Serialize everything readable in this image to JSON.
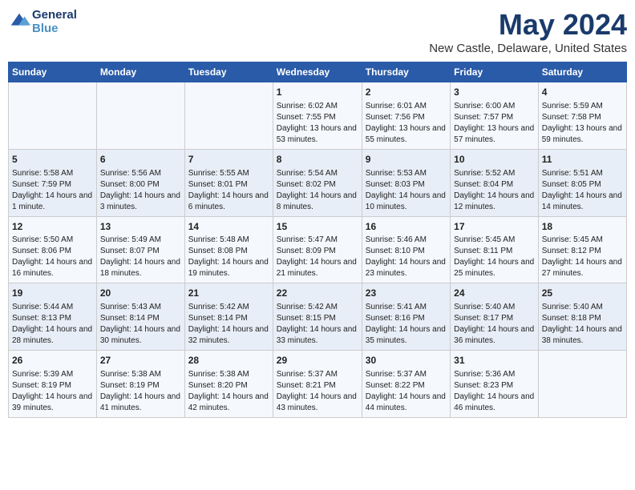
{
  "header": {
    "logo_line1": "General",
    "logo_line2": "Blue",
    "month_title": "May 2024",
    "location": "New Castle, Delaware, United States"
  },
  "days_of_week": [
    "Sunday",
    "Monday",
    "Tuesday",
    "Wednesday",
    "Thursday",
    "Friday",
    "Saturday"
  ],
  "weeks": [
    [
      {
        "day": "",
        "content": ""
      },
      {
        "day": "",
        "content": ""
      },
      {
        "day": "",
        "content": ""
      },
      {
        "day": "1",
        "content": "Sunrise: 6:02 AM\nSunset: 7:55 PM\nDaylight: 13 hours and 53 minutes."
      },
      {
        "day": "2",
        "content": "Sunrise: 6:01 AM\nSunset: 7:56 PM\nDaylight: 13 hours and 55 minutes."
      },
      {
        "day": "3",
        "content": "Sunrise: 6:00 AM\nSunset: 7:57 PM\nDaylight: 13 hours and 57 minutes."
      },
      {
        "day": "4",
        "content": "Sunrise: 5:59 AM\nSunset: 7:58 PM\nDaylight: 13 hours and 59 minutes."
      }
    ],
    [
      {
        "day": "5",
        "content": "Sunrise: 5:58 AM\nSunset: 7:59 PM\nDaylight: 14 hours and 1 minute."
      },
      {
        "day": "6",
        "content": "Sunrise: 5:56 AM\nSunset: 8:00 PM\nDaylight: 14 hours and 3 minutes."
      },
      {
        "day": "7",
        "content": "Sunrise: 5:55 AM\nSunset: 8:01 PM\nDaylight: 14 hours and 6 minutes."
      },
      {
        "day": "8",
        "content": "Sunrise: 5:54 AM\nSunset: 8:02 PM\nDaylight: 14 hours and 8 minutes."
      },
      {
        "day": "9",
        "content": "Sunrise: 5:53 AM\nSunset: 8:03 PM\nDaylight: 14 hours and 10 minutes."
      },
      {
        "day": "10",
        "content": "Sunrise: 5:52 AM\nSunset: 8:04 PM\nDaylight: 14 hours and 12 minutes."
      },
      {
        "day": "11",
        "content": "Sunrise: 5:51 AM\nSunset: 8:05 PM\nDaylight: 14 hours and 14 minutes."
      }
    ],
    [
      {
        "day": "12",
        "content": "Sunrise: 5:50 AM\nSunset: 8:06 PM\nDaylight: 14 hours and 16 minutes."
      },
      {
        "day": "13",
        "content": "Sunrise: 5:49 AM\nSunset: 8:07 PM\nDaylight: 14 hours and 18 minutes."
      },
      {
        "day": "14",
        "content": "Sunrise: 5:48 AM\nSunset: 8:08 PM\nDaylight: 14 hours and 19 minutes."
      },
      {
        "day": "15",
        "content": "Sunrise: 5:47 AM\nSunset: 8:09 PM\nDaylight: 14 hours and 21 minutes."
      },
      {
        "day": "16",
        "content": "Sunrise: 5:46 AM\nSunset: 8:10 PM\nDaylight: 14 hours and 23 minutes."
      },
      {
        "day": "17",
        "content": "Sunrise: 5:45 AM\nSunset: 8:11 PM\nDaylight: 14 hours and 25 minutes."
      },
      {
        "day": "18",
        "content": "Sunrise: 5:45 AM\nSunset: 8:12 PM\nDaylight: 14 hours and 27 minutes."
      }
    ],
    [
      {
        "day": "19",
        "content": "Sunrise: 5:44 AM\nSunset: 8:13 PM\nDaylight: 14 hours and 28 minutes."
      },
      {
        "day": "20",
        "content": "Sunrise: 5:43 AM\nSunset: 8:14 PM\nDaylight: 14 hours and 30 minutes."
      },
      {
        "day": "21",
        "content": "Sunrise: 5:42 AM\nSunset: 8:14 PM\nDaylight: 14 hours and 32 minutes."
      },
      {
        "day": "22",
        "content": "Sunrise: 5:42 AM\nSunset: 8:15 PM\nDaylight: 14 hours and 33 minutes."
      },
      {
        "day": "23",
        "content": "Sunrise: 5:41 AM\nSunset: 8:16 PM\nDaylight: 14 hours and 35 minutes."
      },
      {
        "day": "24",
        "content": "Sunrise: 5:40 AM\nSunset: 8:17 PM\nDaylight: 14 hours and 36 minutes."
      },
      {
        "day": "25",
        "content": "Sunrise: 5:40 AM\nSunset: 8:18 PM\nDaylight: 14 hours and 38 minutes."
      }
    ],
    [
      {
        "day": "26",
        "content": "Sunrise: 5:39 AM\nSunset: 8:19 PM\nDaylight: 14 hours and 39 minutes."
      },
      {
        "day": "27",
        "content": "Sunrise: 5:38 AM\nSunset: 8:19 PM\nDaylight: 14 hours and 41 minutes."
      },
      {
        "day": "28",
        "content": "Sunrise: 5:38 AM\nSunset: 8:20 PM\nDaylight: 14 hours and 42 minutes."
      },
      {
        "day": "29",
        "content": "Sunrise: 5:37 AM\nSunset: 8:21 PM\nDaylight: 14 hours and 43 minutes."
      },
      {
        "day": "30",
        "content": "Sunrise: 5:37 AM\nSunset: 8:22 PM\nDaylight: 14 hours and 44 minutes."
      },
      {
        "day": "31",
        "content": "Sunrise: 5:36 AM\nSunset: 8:23 PM\nDaylight: 14 hours and 46 minutes."
      },
      {
        "day": "",
        "content": ""
      }
    ]
  ]
}
